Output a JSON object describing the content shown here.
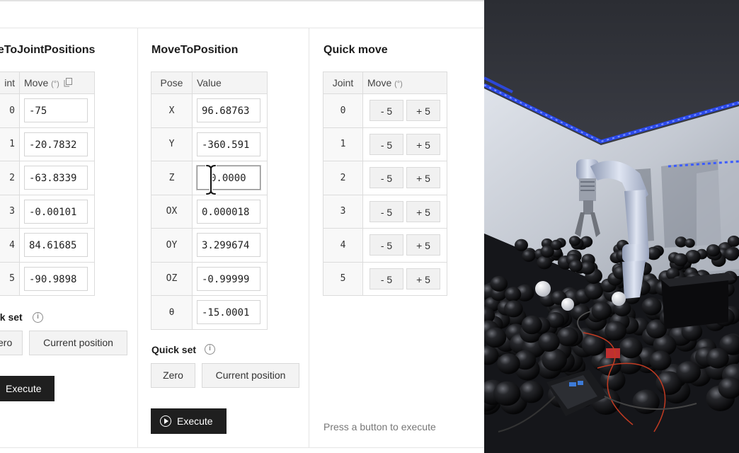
{
  "left_panel": {
    "title": "veToJointPositions",
    "header_joint": "int",
    "header_move": "Move",
    "unit": "(°)",
    "rows": [
      {
        "label": "0",
        "value": "-75"
      },
      {
        "label": "1",
        "value": "-20.7832"
      },
      {
        "label": "2",
        "value": "-63.8339"
      },
      {
        "label": "3",
        "value": "-0.00101"
      },
      {
        "label": "4",
        "value": "84.61685"
      },
      {
        "label": "5",
        "value": "-90.9898"
      }
    ],
    "quick_set_label": "ck set",
    "zero_label": "ero",
    "current_position_label": "Current position",
    "execute_label": "Execute"
  },
  "middle_panel": {
    "title": "MoveToPosition",
    "header_pose": "Pose",
    "header_value": "Value",
    "rows": [
      {
        "label": "X",
        "value": "96.68763"
      },
      {
        "label": "Y",
        "value": "-360.591"
      },
      {
        "label": "Z",
        "value": "0.0000"
      },
      {
        "label": "OX",
        "value": "0.000018"
      },
      {
        "label": "OY",
        "value": "3.299674"
      },
      {
        "label": "OZ",
        "value": "-0.99999"
      },
      {
        "label": "θ",
        "value": "-15.0001"
      }
    ],
    "quick_set_label": "Quick set",
    "zero_label": "Zero",
    "current_position_label": "Current position",
    "execute_label": "Execute"
  },
  "right_panel": {
    "title": "Quick move",
    "header_joint": "Joint",
    "header_move": "Move",
    "unit": "(°)",
    "minus_label": "- 5",
    "plus_label": "+ 5",
    "joints": [
      "0",
      "1",
      "2",
      "3",
      "4",
      "5"
    ],
    "hint": "Press a button to execute"
  },
  "icons": {
    "info": "info-icon",
    "copy": "copy-icon",
    "play": "play-icon",
    "cursor": "text-cursor-icon"
  },
  "colors": {
    "accent_dark": "#1f1f1f",
    "border": "#dcdcdc",
    "led_blue": "#2b4cff"
  }
}
